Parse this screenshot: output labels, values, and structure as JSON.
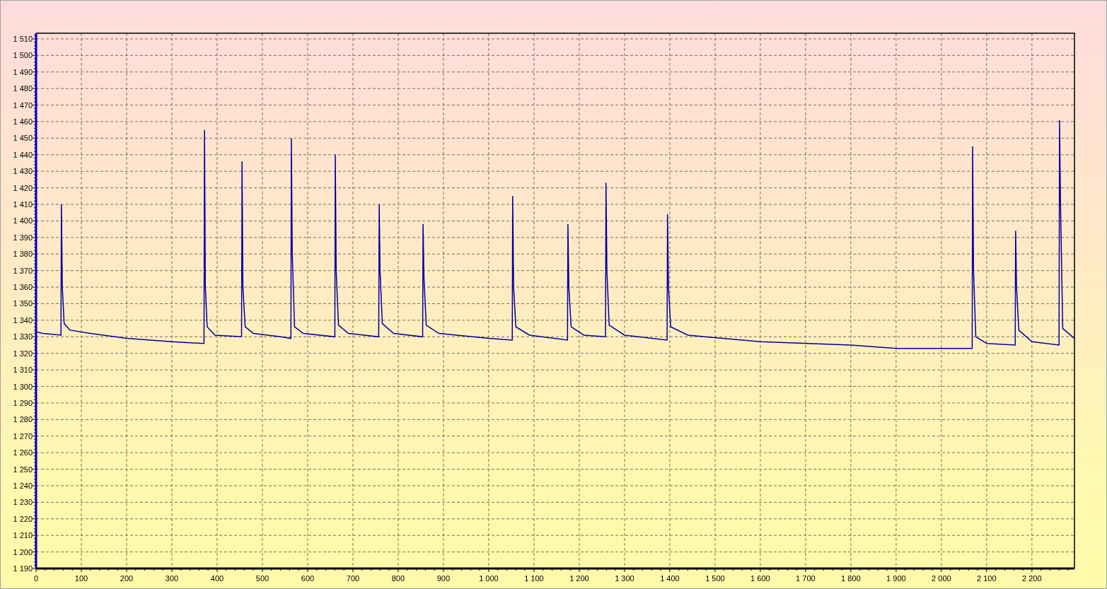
{
  "chart": {
    "chart_data": {
      "type": "line",
      "grid": true,
      "x": [
        0,
        15,
        55,
        56,
        58,
        62,
        75,
        120,
        200,
        300,
        371,
        372,
        374,
        378,
        395,
        454,
        455,
        457,
        462,
        480,
        540,
        563,
        564,
        566,
        571,
        590,
        660,
        661,
        663,
        668,
        690,
        757,
        758,
        760,
        765,
        790,
        854,
        855,
        857,
        862,
        890,
        1000,
        1052,
        1053,
        1055,
        1060,
        1090,
        1174,
        1175,
        1177,
        1182,
        1210,
        1258,
        1259,
        1261,
        1266,
        1300,
        1394,
        1395,
        1397,
        1402,
        1440,
        1600,
        1800,
        1900,
        2068,
        2069,
        2071,
        2076,
        2100,
        2163,
        2164,
        2166,
        2171,
        2200,
        2260,
        2261,
        2263,
        2268,
        2294
      ],
      "series": [
        {
          "color": "#0000a0",
          "values": [
            1333,
            1332,
            1331,
            1410,
            1360,
            1338,
            1334,
            1332,
            1329,
            1327,
            1326,
            1455,
            1360,
            1336,
            1331,
            1330,
            1436,
            1360,
            1336,
            1332,
            1330,
            1329,
            1450,
            1380,
            1336,
            1332,
            1330,
            1440,
            1370,
            1337,
            1332,
            1330,
            1410,
            1370,
            1338,
            1332,
            1330,
            1398,
            1365,
            1337,
            1332,
            1329,
            1328,
            1415,
            1360,
            1336,
            1331,
            1328,
            1398,
            1360,
            1336,
            1331,
            1330,
            1423,
            1370,
            1337,
            1331,
            1328,
            1404,
            1360,
            1336,
            1331,
            1327,
            1325,
            1323,
            1323,
            1445,
            1370,
            1330,
            1326,
            1325,
            1394,
            1360,
            1334,
            1327,
            1325,
            1461,
            1412,
            1335,
            1329
          ]
        }
      ],
      "xlim": [
        0,
        2294
      ],
      "ylim": [
        1190,
        1513.4
      ],
      "xticks": [
        {
          "value": 0,
          "label": "0"
        },
        {
          "value": 100,
          "label": "100"
        },
        {
          "value": 200,
          "label": "200"
        },
        {
          "value": 300,
          "label": "300"
        },
        {
          "value": 400,
          "label": "400"
        },
        {
          "value": 500,
          "label": "500"
        },
        {
          "value": 600,
          "label": "600"
        },
        {
          "value": 700,
          "label": "700"
        },
        {
          "value": 800,
          "label": "800"
        },
        {
          "value": 900,
          "label": "900"
        },
        {
          "value": 1000,
          "label": "1 000"
        },
        {
          "value": 1100,
          "label": "1 100"
        },
        {
          "value": 1200,
          "label": "1 200"
        },
        {
          "value": 1300,
          "label": "1 300"
        },
        {
          "value": 1400,
          "label": "1 400"
        },
        {
          "value": 1500,
          "label": "1 500"
        },
        {
          "value": 1600,
          "label": "1 600"
        },
        {
          "value": 1700,
          "label": "1 700"
        },
        {
          "value": 1800,
          "label": "1 800"
        },
        {
          "value": 1900,
          "label": "1 900"
        },
        {
          "value": 2000,
          "label": "2 000"
        },
        {
          "value": 2100,
          "label": "2 100"
        },
        {
          "value": 2200,
          "label": "2 200"
        }
      ],
      "yticks": [
        {
          "value": 1190,
          "label": "1 190"
        },
        {
          "value": 1200,
          "label": "1 200"
        },
        {
          "value": 1210,
          "label": "1 210"
        },
        {
          "value": 1220,
          "label": "1 220"
        },
        {
          "value": 1230,
          "label": "1 230"
        },
        {
          "value": 1240,
          "label": "1 240"
        },
        {
          "value": 1250,
          "label": "1 250"
        },
        {
          "value": 1260,
          "label": "1 260"
        },
        {
          "value": 1270,
          "label": "1 270"
        },
        {
          "value": 1280,
          "label": "1 280"
        },
        {
          "value": 1290,
          "label": "1 290"
        },
        {
          "value": 1300,
          "label": "1 300"
        },
        {
          "value": 1310,
          "label": "1 310"
        },
        {
          "value": 1320,
          "label": "1 320"
        },
        {
          "value": 1330,
          "label": "1 330"
        },
        {
          "value": 1340,
          "label": "1 340"
        },
        {
          "value": 1350,
          "label": "1 350"
        },
        {
          "value": 1360,
          "label": "1 360"
        },
        {
          "value": 1370,
          "label": "1 370"
        },
        {
          "value": 1380,
          "label": "1 380"
        },
        {
          "value": 1390,
          "label": "1 390"
        },
        {
          "value": 1400,
          "label": "1 400"
        },
        {
          "value": 1410,
          "label": "1 410"
        },
        {
          "value": 1420,
          "label": "1 420"
        },
        {
          "value": 1430,
          "label": "1 430"
        },
        {
          "value": 1440,
          "label": "1 440"
        },
        {
          "value": 1450,
          "label": "1 450"
        },
        {
          "value": 1460,
          "label": "1 460"
        },
        {
          "value": 1470,
          "label": "1 470"
        },
        {
          "value": 1480,
          "label": "1 480"
        },
        {
          "value": 1490,
          "label": "1 490"
        },
        {
          "value": 1500,
          "label": "1 500"
        },
        {
          "value": 1510,
          "label": "1 510"
        }
      ]
    }
  }
}
